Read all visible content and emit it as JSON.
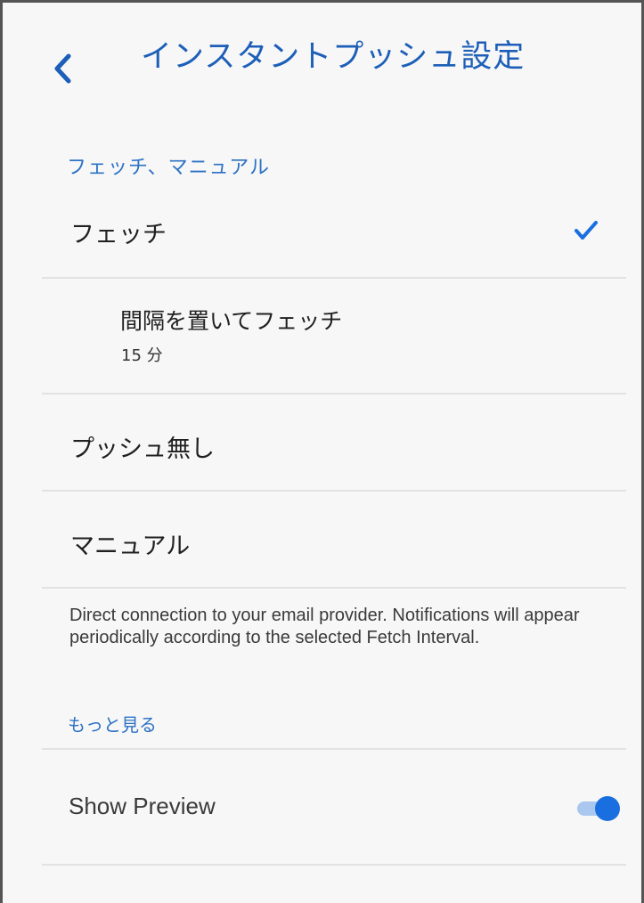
{
  "header": {
    "title": "インスタントプッシュ設定",
    "back_icon": "chevron-left-icon"
  },
  "section": {
    "label": "フェッチ、マニュアル"
  },
  "options": {
    "fetch": {
      "label": "フェッチ",
      "selected": true
    },
    "fetch_interval": {
      "label": "間隔を置いてフェッチ",
      "value": "15 分"
    },
    "no_push": {
      "label": "プッシュ無し"
    },
    "manual": {
      "label": "マニュアル"
    }
  },
  "description": "Direct connection to your email provider. Notifications will appear periodically according to the selected Fetch Interval.",
  "more_link": "もっと見る",
  "show_preview": {
    "label": "Show Preview",
    "enabled": true
  },
  "colors": {
    "accent": "#1a6fe0",
    "section_label": "#2d72c4",
    "title": "#1d5fb8",
    "background": "#f7f7f7"
  }
}
